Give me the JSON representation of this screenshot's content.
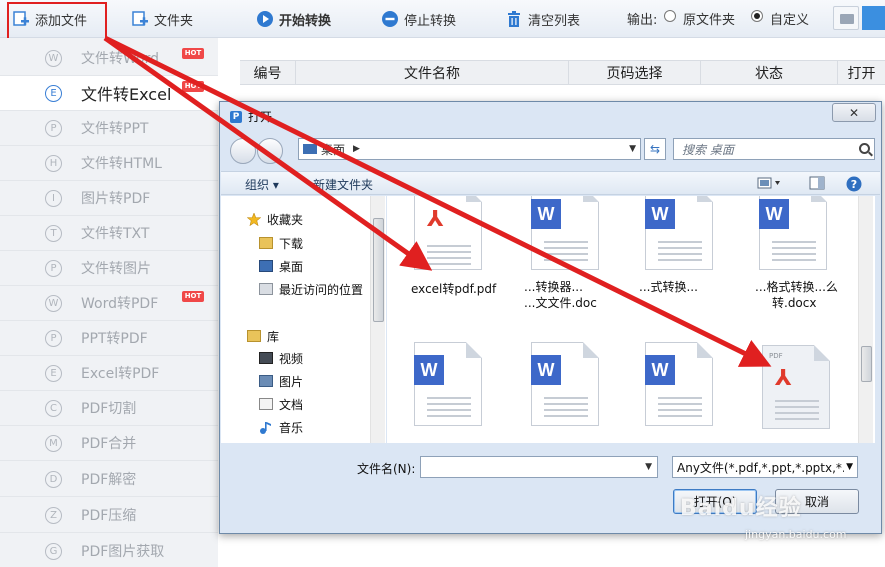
{
  "toolbar": {
    "add_file": "添加文件",
    "folder": "文件夹",
    "start_convert": "开始转换",
    "stop_convert": "停止转换",
    "clear_list": "清空列表",
    "output_label": "输出:",
    "output_options": [
      "原文件夹",
      "自定义"
    ],
    "output_selected": "自定义"
  },
  "sidebar": {
    "items": [
      {
        "icon": "W",
        "label": "文件转Word",
        "hot": true
      },
      {
        "icon": "E",
        "label": "文件转Excel",
        "hot": true,
        "active": true
      },
      {
        "icon": "P",
        "label": "文件转PPT"
      },
      {
        "icon": "H",
        "label": "文件转HTML"
      },
      {
        "icon": "I",
        "label": "图片转PDF"
      },
      {
        "icon": "T",
        "label": "文件转TXT"
      },
      {
        "icon": "P",
        "label": "文件转图片"
      },
      {
        "icon": "W",
        "label": "Word转PDF",
        "hot": true
      },
      {
        "icon": "P",
        "label": "PPT转PDF"
      },
      {
        "icon": "E",
        "label": "Excel转PDF"
      },
      {
        "icon": "C",
        "label": "PDF切割"
      },
      {
        "icon": "M",
        "label": "PDF合并"
      },
      {
        "icon": "D",
        "label": "PDF解密"
      },
      {
        "icon": "Z",
        "label": "PDF压缩"
      },
      {
        "icon": "G",
        "label": "PDF图片获取"
      }
    ],
    "hot_text": "HOT"
  },
  "table": {
    "headers": [
      "编号",
      "文件名称",
      "页码选择",
      "状态",
      "打开"
    ]
  },
  "dialog": {
    "title": "打开",
    "close": "✕",
    "address": "桌面",
    "search_placeholder": "搜索 桌面",
    "organize": "组织 ▾",
    "new_folder": "新建文件夹",
    "tree": {
      "favorites": "收藏夹",
      "favorites_items": [
        "下载",
        "桌面",
        "最近访问的位置"
      ],
      "libraries": "库",
      "library_items": [
        "视频",
        "图片",
        "文档",
        "音乐"
      ]
    },
    "files_row1": [
      {
        "type": "pdf",
        "name": "excel转pdf.pdf"
      },
      {
        "type": "word",
        "name_line1": "...转换器...",
        "name_line2": "...文文件.doc"
      },
      {
        "type": "word",
        "name_line1": "...式转换...",
        "name_line2": ""
      },
      {
        "type": "word",
        "name_line1": "...格式转换...么",
        "name_line2": "转.docx"
      }
    ],
    "files_row2": [
      {
        "type": "word",
        "name": ""
      },
      {
        "type": "word",
        "name": ""
      },
      {
        "type": "word",
        "name": ""
      },
      {
        "type": "pdf",
        "name": ""
      }
    ],
    "pdf_tag": "PDF",
    "filename_label": "文件名(N):",
    "filename_value": "",
    "filetype": "Any文件(*.pdf,*.ppt,*.pptx,*.d",
    "open_btn": "打开(O)",
    "cancel_btn": "取消"
  },
  "watermark": {
    "main": "Baidu经验",
    "sub": "jingyan.baidu.com"
  },
  "colors": {
    "annotation_red": "#e02020",
    "word_blue": "#3d68c9",
    "pdf_red": "#e03a2c",
    "active_blue": "#3a7fd5"
  }
}
